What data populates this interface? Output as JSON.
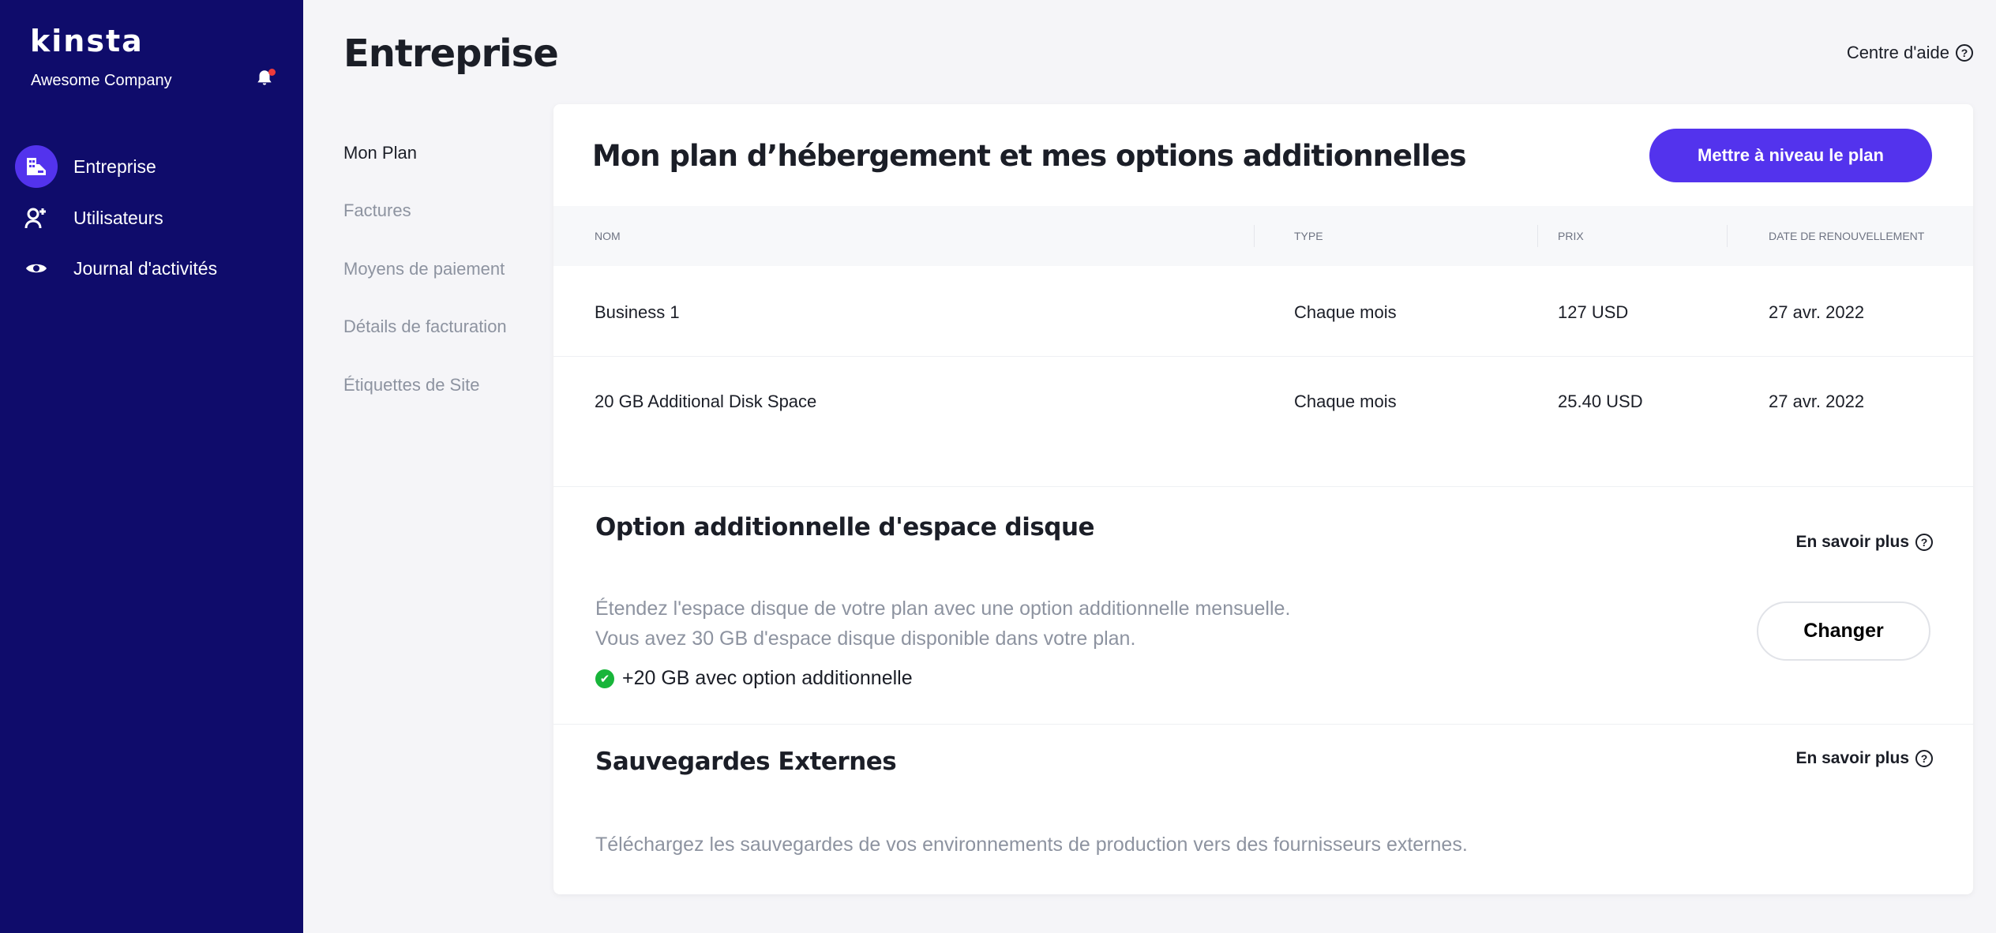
{
  "sidebar": {
    "logo": "kinsta",
    "company": "Awesome Company",
    "items": [
      {
        "label": "Entreprise",
        "icon": "building-icon"
      },
      {
        "label": "Utilisateurs",
        "icon": "user-plus-icon"
      },
      {
        "label": "Journal d'activités",
        "icon": "eye-icon"
      }
    ]
  },
  "header": {
    "title": "Entreprise",
    "help": "Centre d'aide"
  },
  "subnav": [
    "Mon Plan",
    "Factures",
    "Moyens de paiement",
    "Détails de facturation",
    "Étiquettes de Site"
  ],
  "plan": {
    "title": "Mon plan d’hébergement et mes options additionnelles",
    "upgrade": "Mettre à niveau le plan",
    "columns": [
      "Nom",
      "Type",
      "Prix",
      "Date de renouvellement"
    ],
    "rows": [
      [
        "Business 1",
        "Chaque mois",
        "127 USD",
        "27 avr. 2022"
      ],
      [
        "20 GB Additional Disk Space",
        "Chaque mois",
        "25.40 USD",
        "27 avr. 2022"
      ]
    ]
  },
  "disk": {
    "title": "Option additionnelle d'espace disque",
    "more": "En savoir plus",
    "line1": "Étendez l'espace disque de votre plan avec une option additionnelle mensuelle.",
    "line2": "Vous avez 30 GB d'espace disque disponible dans votre plan.",
    "check": "+20 GB avec option additionnelle",
    "change": "Changer"
  },
  "backup": {
    "title": "Sauvegardes Externes",
    "more": "En savoir plus",
    "desc": "Téléchargez les sauvegardes de vos environnements de production vers des fournisseurs externes."
  },
  "colors": {
    "sidebar": "#0f0c6b",
    "accent": "#5333ed",
    "success": "#18b53a"
  }
}
